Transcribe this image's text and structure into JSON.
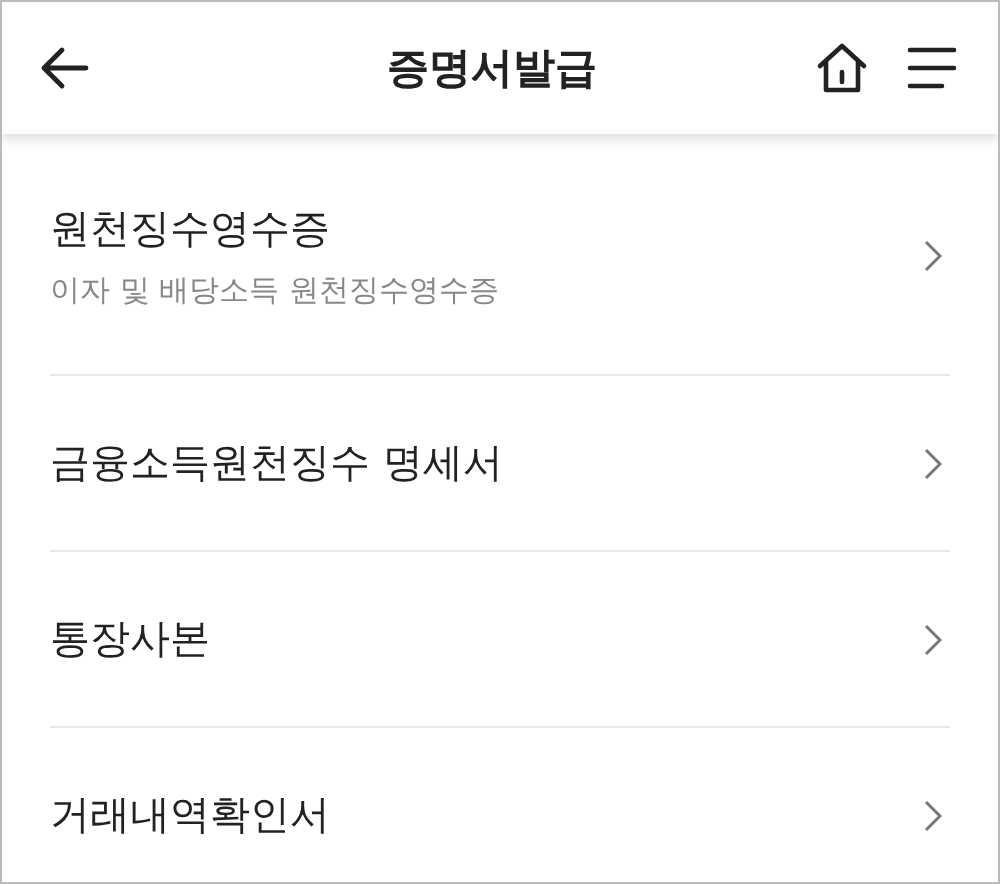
{
  "header": {
    "title": "증명서발급"
  },
  "items": [
    {
      "title": "원천징수영수증",
      "subtitle": "이자 및 배당소득 원천징수영수증"
    },
    {
      "title": "금융소득원천징수 명세서"
    },
    {
      "title": "통장사본"
    },
    {
      "title": "거래내역확인서"
    }
  ]
}
